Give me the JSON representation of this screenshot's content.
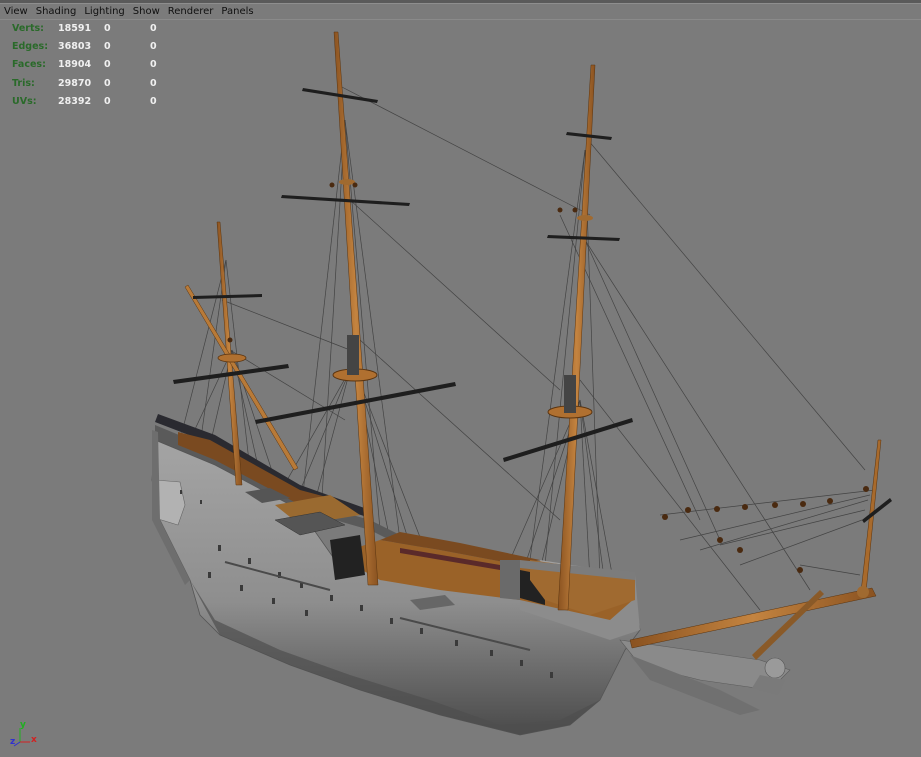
{
  "menu": {
    "items": [
      "View",
      "Shading",
      "Lighting",
      "Show",
      "Renderer",
      "Panels"
    ]
  },
  "hud": {
    "rows": [
      {
        "label": "Verts:",
        "total": "18591",
        "selected": "0",
        "uv": "0"
      },
      {
        "label": "Edges:",
        "total": "36803",
        "selected": "0",
        "uv": "0"
      },
      {
        "label": "Faces:",
        "total": "18904",
        "selected": "0",
        "uv": "0"
      },
      {
        "label": "Tris:",
        "total": "29870",
        "selected": "0",
        "uv": "0"
      },
      {
        "label": "UVs:",
        "total": "28392",
        "selected": "0",
        "uv": "0"
      }
    ]
  },
  "axis": {
    "x": "x",
    "y": "y",
    "z": "z"
  },
  "colors": {
    "viewport_bg": "#7b7b7b",
    "hud_label": "#2a6a2a",
    "hud_value": "#f0f0f0",
    "wood": "#a86a2c",
    "hull": "#9a9a9a",
    "axis_x": "#d42020",
    "axis_y": "#20b020",
    "axis_z": "#3030d0"
  }
}
